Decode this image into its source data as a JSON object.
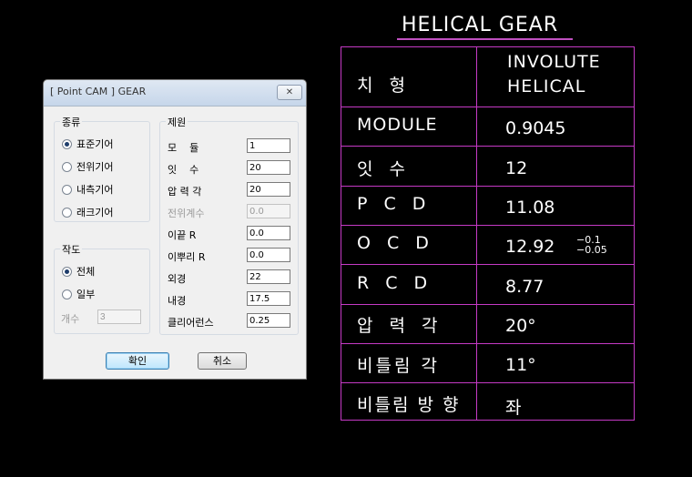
{
  "dialog": {
    "title": "[ Point CAM ] GEAR",
    "close_glyph": "✕",
    "type_group": {
      "title": "종류",
      "options": [
        "표준기어",
        "전위기어",
        "내측기어",
        "래크기어"
      ],
      "selected": "표준기어"
    },
    "draw_group": {
      "title": "작도",
      "options": [
        "전체",
        "일부"
      ],
      "selected": "전체",
      "count_label": "개수",
      "count_value": "3"
    },
    "spec_group": {
      "title": "제원",
      "fields": [
        {
          "label": "모    듈",
          "value": "1",
          "enabled": true
        },
        {
          "label": "잇    수",
          "value": "20",
          "enabled": true
        },
        {
          "label": "압 력 각",
          "value": "20",
          "enabled": true
        },
        {
          "label": "전위계수",
          "value": "0.0",
          "enabled": false
        },
        {
          "label": "이끝 R",
          "value": "0.0",
          "enabled": true
        },
        {
          "label": "이뿌리 R",
          "value": "0.0",
          "enabled": true
        },
        {
          "label": "외경",
          "value": "22",
          "enabled": true
        },
        {
          "label": "내경",
          "value": "17.5",
          "enabled": true
        },
        {
          "label": "클리어런스",
          "value": "0.25",
          "enabled": true
        }
      ]
    },
    "ok_label": "확인",
    "cancel_label": "취소"
  },
  "cad": {
    "title": "HELICAL GEAR",
    "line_color": "#c53ac5",
    "rows": [
      {
        "label": "치 형",
        "value_line1": "INVOLUTE",
        "value_line2": "HELICAL"
      },
      {
        "label": "MODULE",
        "value": "0.9045"
      },
      {
        "label": "잇 수",
        "value": "12"
      },
      {
        "label": "P C D",
        "value": "11.08"
      },
      {
        "label": "O C D",
        "value": "12.92",
        "tol_upper": "−0.1",
        "tol_lower": "−0.05"
      },
      {
        "label": "R C D",
        "value": "8.77"
      },
      {
        "label": "압 력 각",
        "value": "20°"
      },
      {
        "label": "비틀림 각",
        "value": "11°"
      },
      {
        "label": "비틀림 방 향",
        "value": "좌"
      }
    ]
  }
}
